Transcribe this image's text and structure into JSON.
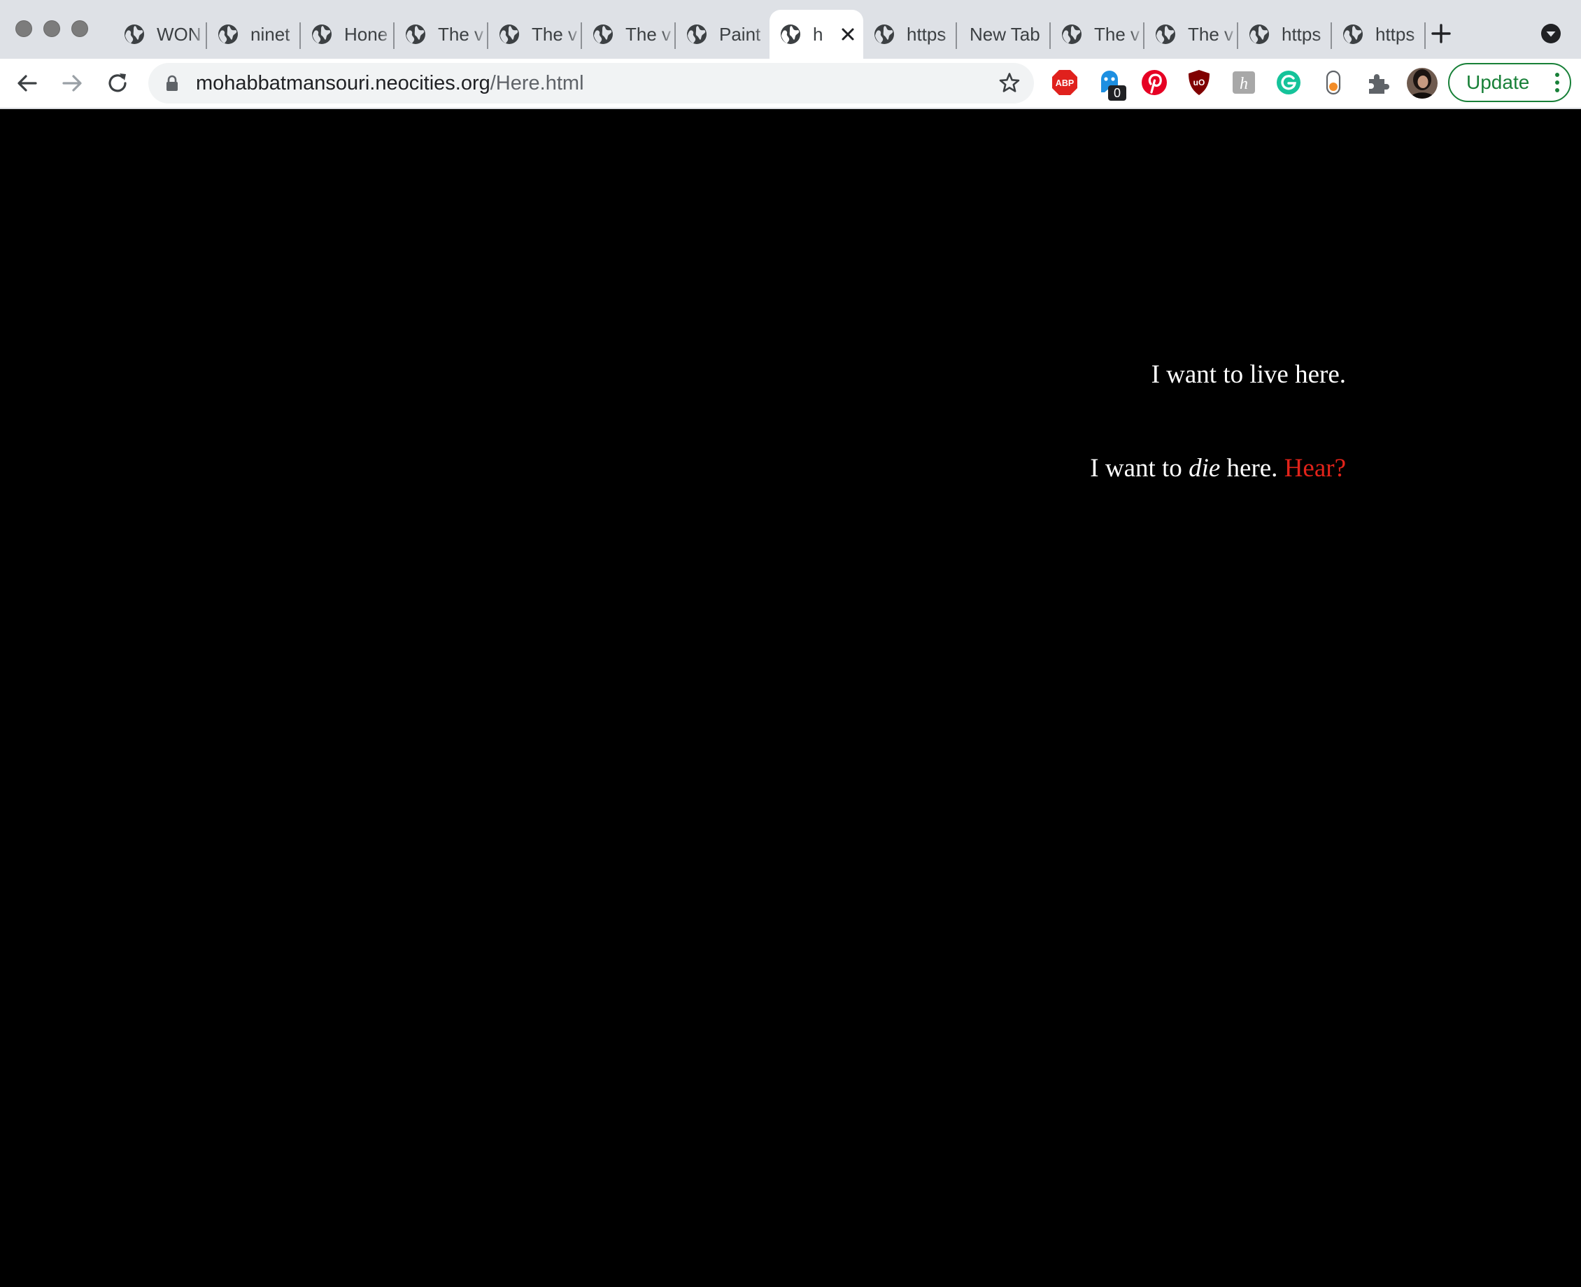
{
  "tabs": [
    {
      "title": "WON",
      "icon": "globe-icon"
    },
    {
      "title": "ninet",
      "icon": "globe-icon"
    },
    {
      "title": "Hone",
      "icon": "globe-icon"
    },
    {
      "title": "The v",
      "icon": "globe-icon"
    },
    {
      "title": "The v",
      "icon": "globe-icon"
    },
    {
      "title": "The v",
      "icon": "globe-icon"
    },
    {
      "title": "Paint",
      "icon": "globe-icon"
    },
    {
      "title": "h",
      "icon": "globe-icon",
      "active": true
    },
    {
      "title": "https",
      "icon": "globe-icon"
    },
    {
      "title": "New Tab"
    },
    {
      "title": "The v",
      "icon": "globe-icon"
    },
    {
      "title": "The v",
      "icon": "globe-icon"
    },
    {
      "title": "https",
      "icon": "globe-icon"
    },
    {
      "title": "https",
      "icon": "globe-icon"
    }
  ],
  "address_bar": {
    "host": "mohabbatmansouri.neocities.org",
    "path": "/Here.html"
  },
  "extensions": [
    {
      "name": "adblock-plus-icon",
      "label": "ABP",
      "color": "#e0211d"
    },
    {
      "name": "ghostery-icon",
      "badge": "0",
      "color": "#1d8fe1"
    },
    {
      "name": "pinterest-icon",
      "color": "#e60023"
    },
    {
      "name": "ublock-origin-icon",
      "label": "uO",
      "color": "#800000"
    },
    {
      "name": "honey-icon",
      "label": "h",
      "color": "#a8a8a8"
    },
    {
      "name": "grammarly-icon",
      "label": "G",
      "color": "#15c39a"
    },
    {
      "name": "record-extension-icon",
      "color": "#f28c28"
    },
    {
      "name": "extensions-puzzle-icon",
      "color": "#5f6368"
    }
  ],
  "update_button": {
    "label": "Update"
  },
  "page": {
    "background": "#000000",
    "line1": "I want to live here.",
    "line2_prefix": "I want to ",
    "line2_emphasis": "die",
    "line2_suffix": " here. ",
    "line2_link": "Hear?",
    "link_color": "#e2231a"
  }
}
